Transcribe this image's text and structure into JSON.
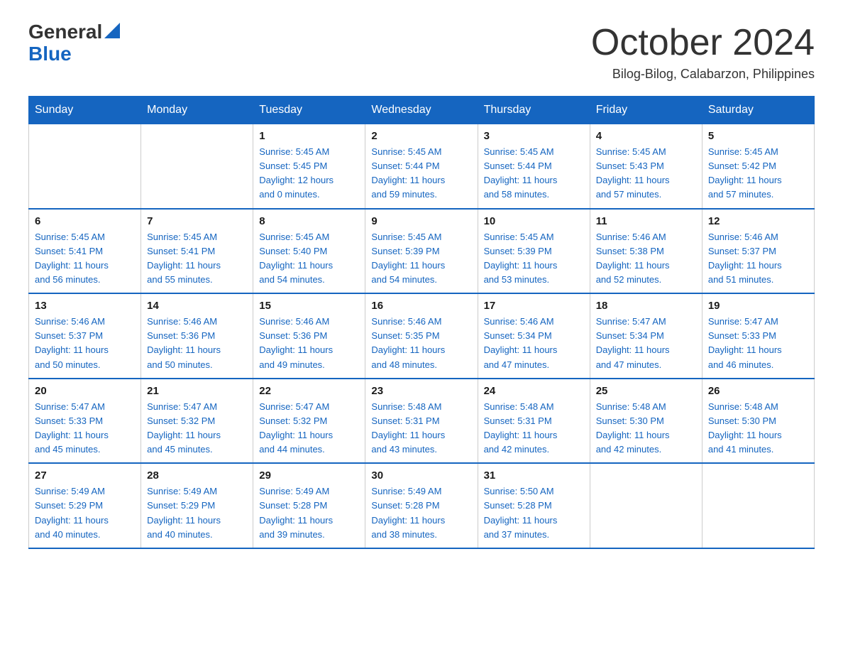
{
  "header": {
    "logo_general": "General",
    "logo_blue": "Blue",
    "month_title": "October 2024",
    "subtitle": "Bilog-Bilog, Calabarzon, Philippines"
  },
  "columns": [
    "Sunday",
    "Monday",
    "Tuesday",
    "Wednesday",
    "Thursday",
    "Friday",
    "Saturday"
  ],
  "weeks": [
    [
      {
        "day": "",
        "info": ""
      },
      {
        "day": "",
        "info": ""
      },
      {
        "day": "1",
        "info": "Sunrise: 5:45 AM\nSunset: 5:45 PM\nDaylight: 12 hours\nand 0 minutes."
      },
      {
        "day": "2",
        "info": "Sunrise: 5:45 AM\nSunset: 5:44 PM\nDaylight: 11 hours\nand 59 minutes."
      },
      {
        "day": "3",
        "info": "Sunrise: 5:45 AM\nSunset: 5:44 PM\nDaylight: 11 hours\nand 58 minutes."
      },
      {
        "day": "4",
        "info": "Sunrise: 5:45 AM\nSunset: 5:43 PM\nDaylight: 11 hours\nand 57 minutes."
      },
      {
        "day": "5",
        "info": "Sunrise: 5:45 AM\nSunset: 5:42 PM\nDaylight: 11 hours\nand 57 minutes."
      }
    ],
    [
      {
        "day": "6",
        "info": "Sunrise: 5:45 AM\nSunset: 5:41 PM\nDaylight: 11 hours\nand 56 minutes."
      },
      {
        "day": "7",
        "info": "Sunrise: 5:45 AM\nSunset: 5:41 PM\nDaylight: 11 hours\nand 55 minutes."
      },
      {
        "day": "8",
        "info": "Sunrise: 5:45 AM\nSunset: 5:40 PM\nDaylight: 11 hours\nand 54 minutes."
      },
      {
        "day": "9",
        "info": "Sunrise: 5:45 AM\nSunset: 5:39 PM\nDaylight: 11 hours\nand 54 minutes."
      },
      {
        "day": "10",
        "info": "Sunrise: 5:45 AM\nSunset: 5:39 PM\nDaylight: 11 hours\nand 53 minutes."
      },
      {
        "day": "11",
        "info": "Sunrise: 5:46 AM\nSunset: 5:38 PM\nDaylight: 11 hours\nand 52 minutes."
      },
      {
        "day": "12",
        "info": "Sunrise: 5:46 AM\nSunset: 5:37 PM\nDaylight: 11 hours\nand 51 minutes."
      }
    ],
    [
      {
        "day": "13",
        "info": "Sunrise: 5:46 AM\nSunset: 5:37 PM\nDaylight: 11 hours\nand 50 minutes."
      },
      {
        "day": "14",
        "info": "Sunrise: 5:46 AM\nSunset: 5:36 PM\nDaylight: 11 hours\nand 50 minutes."
      },
      {
        "day": "15",
        "info": "Sunrise: 5:46 AM\nSunset: 5:36 PM\nDaylight: 11 hours\nand 49 minutes."
      },
      {
        "day": "16",
        "info": "Sunrise: 5:46 AM\nSunset: 5:35 PM\nDaylight: 11 hours\nand 48 minutes."
      },
      {
        "day": "17",
        "info": "Sunrise: 5:46 AM\nSunset: 5:34 PM\nDaylight: 11 hours\nand 47 minutes."
      },
      {
        "day": "18",
        "info": "Sunrise: 5:47 AM\nSunset: 5:34 PM\nDaylight: 11 hours\nand 47 minutes."
      },
      {
        "day": "19",
        "info": "Sunrise: 5:47 AM\nSunset: 5:33 PM\nDaylight: 11 hours\nand 46 minutes."
      }
    ],
    [
      {
        "day": "20",
        "info": "Sunrise: 5:47 AM\nSunset: 5:33 PM\nDaylight: 11 hours\nand 45 minutes."
      },
      {
        "day": "21",
        "info": "Sunrise: 5:47 AM\nSunset: 5:32 PM\nDaylight: 11 hours\nand 45 minutes."
      },
      {
        "day": "22",
        "info": "Sunrise: 5:47 AM\nSunset: 5:32 PM\nDaylight: 11 hours\nand 44 minutes."
      },
      {
        "day": "23",
        "info": "Sunrise: 5:48 AM\nSunset: 5:31 PM\nDaylight: 11 hours\nand 43 minutes."
      },
      {
        "day": "24",
        "info": "Sunrise: 5:48 AM\nSunset: 5:31 PM\nDaylight: 11 hours\nand 42 minutes."
      },
      {
        "day": "25",
        "info": "Sunrise: 5:48 AM\nSunset: 5:30 PM\nDaylight: 11 hours\nand 42 minutes."
      },
      {
        "day": "26",
        "info": "Sunrise: 5:48 AM\nSunset: 5:30 PM\nDaylight: 11 hours\nand 41 minutes."
      }
    ],
    [
      {
        "day": "27",
        "info": "Sunrise: 5:49 AM\nSunset: 5:29 PM\nDaylight: 11 hours\nand 40 minutes."
      },
      {
        "day": "28",
        "info": "Sunrise: 5:49 AM\nSunset: 5:29 PM\nDaylight: 11 hours\nand 40 minutes."
      },
      {
        "day": "29",
        "info": "Sunrise: 5:49 AM\nSunset: 5:28 PM\nDaylight: 11 hours\nand 39 minutes."
      },
      {
        "day": "30",
        "info": "Sunrise: 5:49 AM\nSunset: 5:28 PM\nDaylight: 11 hours\nand 38 minutes."
      },
      {
        "day": "31",
        "info": "Sunrise: 5:50 AM\nSunset: 5:28 PM\nDaylight: 11 hours\nand 37 minutes."
      },
      {
        "day": "",
        "info": ""
      },
      {
        "day": "",
        "info": ""
      }
    ]
  ]
}
